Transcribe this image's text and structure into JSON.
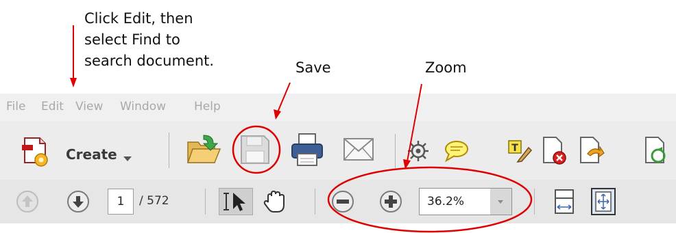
{
  "annotations": {
    "instruction_lines": [
      "Click Edit, then",
      "select Find to",
      "search document."
    ],
    "save_label": "Save",
    "zoom_label": "Zoom"
  },
  "menu": {
    "items": [
      "File",
      "Edit",
      "View",
      "Window",
      "Help"
    ]
  },
  "toolbar": {
    "create_label": "Create",
    "tools": [
      "open-icon",
      "save-icon",
      "print-icon",
      "email-icon",
      "gear-icon",
      "comment-icon",
      "text-edit-icon",
      "delete-page-icon",
      "export-icon",
      "rotate-icon"
    ]
  },
  "navigation": {
    "current_page": "1",
    "page_total": "/ 572",
    "zoom_value": "36.2%"
  },
  "colors": {
    "annotation_red": "#e00000",
    "menubar_bg": "#f0f0f0",
    "toolbar_bg": "#ececec"
  }
}
